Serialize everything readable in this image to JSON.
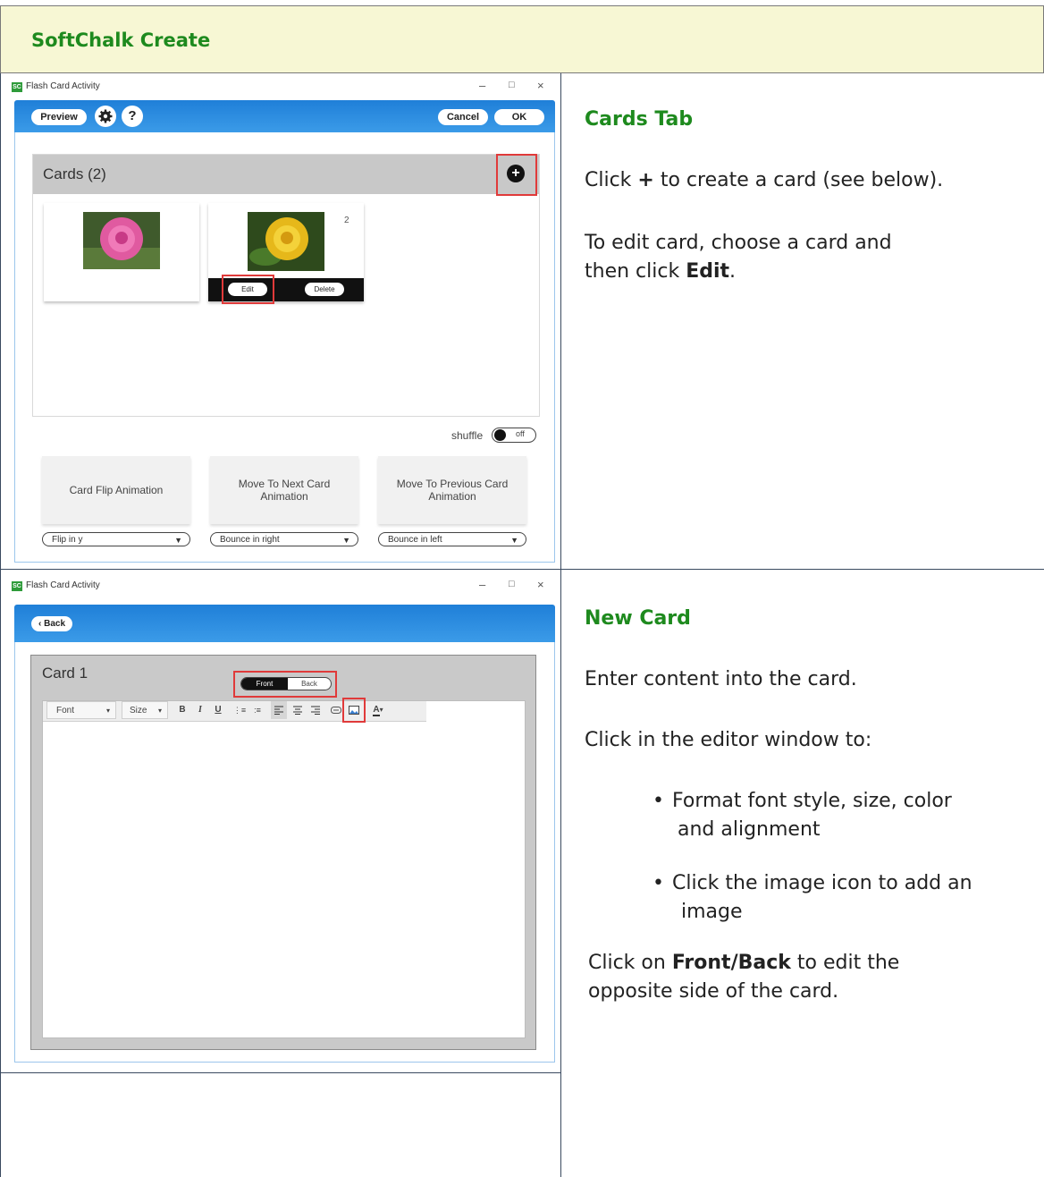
{
  "header": {
    "title": "SoftChalk Create"
  },
  "section1": {
    "window": {
      "title": "Flash Card Activity",
      "preview_label": "Preview",
      "settings_icon": "gear-icon",
      "help_label": "?",
      "cancel_label": "Cancel",
      "ok_label": "OK",
      "cards_heading": "Cards (2)",
      "add_label": "+",
      "card2_number": "2",
      "edit_label": "Edit",
      "delete_label": "Delete",
      "shuffle_label": "shuffle",
      "shuffle_state": "off",
      "animations": [
        {
          "label": "Card Flip Animation",
          "select": "Flip in y"
        },
        {
          "label": "Move To Next Card Animation",
          "select": "Bounce in right"
        },
        {
          "label": "Move To Previous Card Animation",
          "select": "Bounce in left"
        }
      ]
    },
    "right": {
      "title": "Cards Tab",
      "p1_pre": "Click ",
      "p1_bold": "+",
      "p1_post": " to create a card (see below).",
      "p2_line1": "To edit card, choose a card and",
      "p2_pre": "then click ",
      "p2_bold": "Edit",
      "p2_post": "."
    }
  },
  "section2": {
    "window": {
      "title": "Flash Card Activity",
      "back_label": "Back",
      "card_heading": "Card 1",
      "front_label": "Front",
      "back_tab_label": "Back",
      "font_label": "Font",
      "size_label": "Size",
      "bold_label": "B",
      "italic_label": "I",
      "underline_label": "U"
    },
    "right": {
      "title": "New Card",
      "p1": "Enter content into the card.",
      "p2": "Click in the editor window to:",
      "bullet1_line1": "Format font style, size, color",
      "bullet1_line2": "and alignment",
      "bullet2_line1": "Click the image icon to add an",
      "bullet2_line2": "image",
      "p3_bold": "Front/Back",
      "p3_pre": "Click on ",
      "p3_post": " to edit the",
      "p3_line2": "opposite side of the card."
    }
  },
  "colors": {
    "header_bg": "#f7f7d4",
    "title_green": "#1e8a1e",
    "app_blue": "#1f7fd8",
    "highlight_red": "#e03a3a"
  }
}
